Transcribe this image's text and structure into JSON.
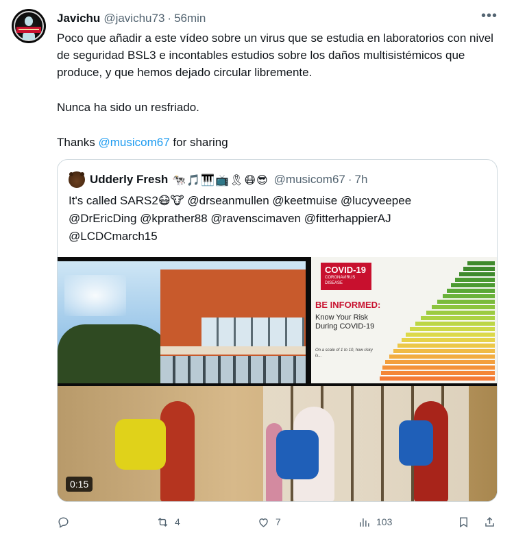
{
  "tweet": {
    "author_name": "Javichu",
    "author_handle": "@javichu73",
    "separator": "·",
    "time": "56min",
    "more": "•••",
    "paragraph1": "Poco que añadir a este vídeo sobre un virus que se estudia en laboratorios con nivel de seguridad BSL3 e incontables estudios sobre los daños multisistémicos que produce, y que hemos dejado circular libremente.",
    "paragraph2": "Nunca ha sido un resfriado.",
    "paragraph3_prefix": "Thanks ",
    "paragraph3_mention": "@musicom67",
    "paragraph3_suffix": " for sharing"
  },
  "quoted": {
    "author_name": "Udderly Fresh",
    "emojis": "🐄🎵🎹📺🎗😷😎",
    "author_handle": "@musicom67",
    "separator": "·",
    "time": "7h",
    "text_prefix": "It's called SARS2",
    "text_emojis": "😷🐮",
    "mentions_line1": "@drseanmullen @keetmuise @lucyveepee",
    "mentions_line2": "@DrEricDing @kprather88 @ravenscimaven @fitterhappierAJ",
    "mentions_line3": "@LCDCmarch15",
    "video_duration": "0:15",
    "poster": {
      "title": "COVID-19",
      "subtitle": "CORONAVIRUS DISEASE",
      "be_informed": "BE INFORMED:",
      "know": "Know Your Risk During COVID-19",
      "scale": "On a scale of 1 to 10, how risky is..."
    }
  },
  "actions": {
    "reply_count": "",
    "retweet_count": "4",
    "like_count": "7",
    "views_count": "103"
  },
  "colors": {
    "text": "#0f1419",
    "secondary": "#536471",
    "link": "#1d9bf0",
    "border": "#cfd9de"
  }
}
